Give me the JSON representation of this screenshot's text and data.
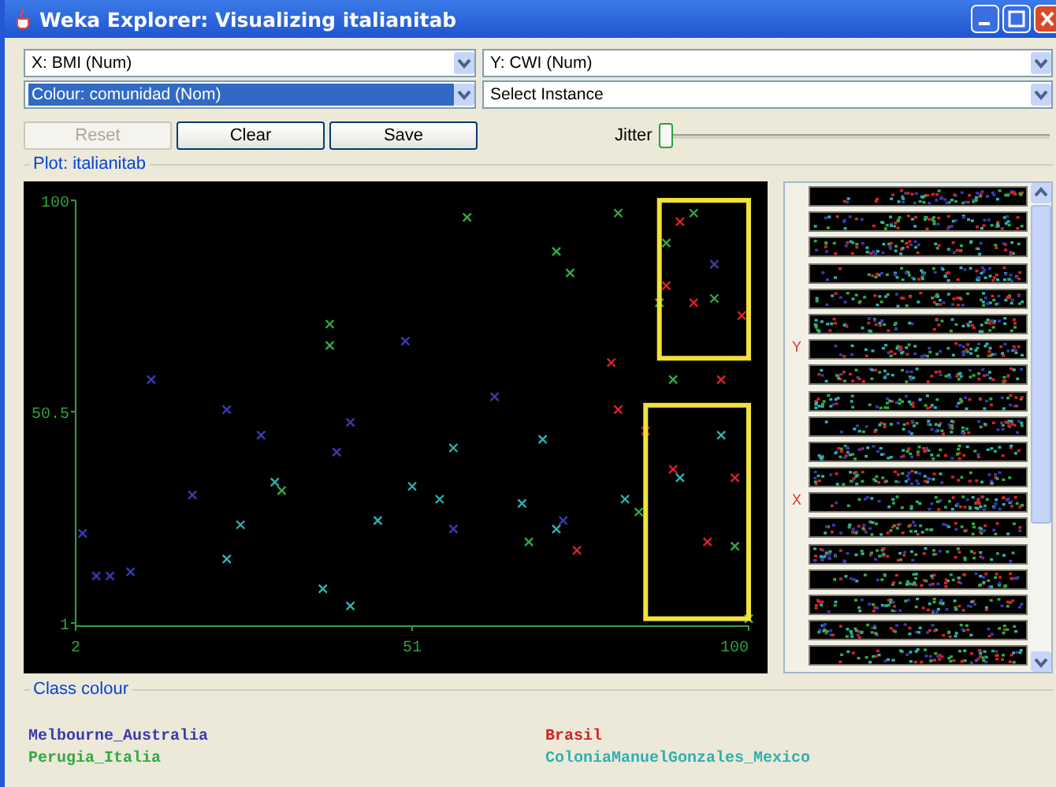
{
  "window": {
    "title": "Weka Explorer: Visualizing italianitab"
  },
  "selectors": [
    {
      "value": "X: BMI (Num)",
      "focused": false
    },
    {
      "value": "Y: CWI (Num)",
      "focused": false
    },
    {
      "value": "Colour: comunidad (Nom)",
      "focused": true
    },
    {
      "value": "Select Instance",
      "focused": false
    }
  ],
  "buttons": [
    {
      "label": "Reset",
      "disabled": true
    },
    {
      "label": "Clear",
      "disabled": false
    },
    {
      "label": "Save",
      "disabled": false
    }
  ],
  "jitter": {
    "label": "Jitter",
    "level": 0
  },
  "plot": {
    "title": "Plot: italianitab",
    "chart_data": {
      "type": "scatter",
      "xlim": [
        2,
        100
      ],
      "ylim": [
        1,
        100
      ],
      "xticks": [
        2,
        51,
        100
      ],
      "yticks": [
        1,
        50.5,
        100
      ],
      "x": [
        3,
        5,
        7,
        10,
        13,
        19,
        24,
        29,
        40,
        42,
        50,
        57,
        63,
        73,
        95,
        75,
        80,
        81,
        88,
        90,
        92,
        96,
        99,
        85,
        89,
        98,
        94,
        32,
        39,
        39,
        59,
        72,
        74,
        68,
        81,
        88,
        92,
        87,
        95,
        89,
        84,
        98,
        24,
        26,
        31,
        38,
        42,
        46,
        51,
        55,
        57,
        67,
        70,
        72,
        82,
        90,
        96,
        100
      ],
      "series": [
        {
          "name": "Melbourne_Australia",
          "color": "#3a3ab0",
          "values": [
            22,
            12,
            12,
            13,
            58,
            31,
            51,
            45,
            41,
            48,
            67,
            23,
            54,
            25,
            85,
            null,
            null,
            null,
            null,
            null,
            null,
            null,
            null,
            null,
            null,
            null,
            null,
            null,
            null,
            null,
            null,
            null,
            null,
            null,
            null,
            null,
            null,
            null,
            null,
            null,
            null,
            null,
            null,
            null,
            null,
            null,
            null,
            null,
            null,
            null,
            null,
            null,
            null,
            null,
            null,
            null,
            null,
            null
          ]
        },
        {
          "name": "Brasil",
          "color": "#d42424",
          "values": [
            null,
            null,
            null,
            null,
            null,
            null,
            null,
            null,
            null,
            null,
            null,
            null,
            null,
            null,
            null,
            18,
            62,
            51,
            80,
            95,
            76,
            58,
            73,
            46,
            37,
            35,
            20,
            null,
            null,
            null,
            null,
            null,
            null,
            null,
            null,
            null,
            null,
            null,
            null,
            null,
            null,
            null,
            null,
            null,
            null,
            null,
            null,
            null,
            null,
            null,
            null,
            null,
            null,
            null,
            null,
            null,
            null,
            null
          ]
        },
        {
          "name": "Perugia_Italia",
          "color": "#33a844",
          "values": [
            null,
            null,
            null,
            null,
            null,
            null,
            null,
            null,
            null,
            null,
            null,
            null,
            null,
            null,
            null,
            null,
            null,
            null,
            null,
            null,
            null,
            null,
            null,
            null,
            null,
            null,
            null,
            32,
            66,
            71,
            96,
            88,
            83,
            20,
            97,
            90,
            97,
            76,
            77,
            58,
            27,
            19,
            null,
            null,
            null,
            null,
            null,
            null,
            null,
            null,
            null,
            null,
            null,
            null,
            null,
            null,
            null,
            null
          ]
        },
        {
          "name": "ColoniaManuelGonzales_Mexico",
          "color": "#2fb0b0",
          "values": [
            null,
            null,
            null,
            null,
            null,
            null,
            null,
            null,
            null,
            null,
            null,
            null,
            null,
            null,
            null,
            null,
            null,
            null,
            null,
            null,
            null,
            null,
            null,
            null,
            null,
            null,
            null,
            null,
            null,
            null,
            null,
            null,
            null,
            null,
            null,
            null,
            null,
            null,
            null,
            null,
            null,
            null,
            16,
            24,
            34,
            9,
            5,
            25,
            33,
            30,
            42,
            29,
            44,
            23,
            30,
            35,
            45,
            2
          ]
        }
      ]
    }
  },
  "attribute_strips": [
    {
      "kind": "plain"
    },
    {
      "kind": "plain"
    },
    {
      "kind": "plain"
    },
    {
      "kind": "plain"
    },
    {
      "kind": "plain"
    },
    {
      "kind": "plain"
    },
    {
      "kind": "marked",
      "marker": "Y"
    },
    {
      "kind": "plain"
    },
    {
      "kind": "plain"
    },
    {
      "kind": "plain"
    },
    {
      "kind": "plain"
    },
    {
      "kind": "plain"
    },
    {
      "kind": "marked",
      "marker": "X"
    },
    {
      "kind": "plain"
    },
    {
      "kind": "plain"
    },
    {
      "kind": "plain"
    },
    {
      "kind": "plain"
    },
    {
      "kind": "plain"
    },
    {
      "kind": "plain"
    }
  ],
  "class_colour": {
    "title": "Class colour"
  }
}
